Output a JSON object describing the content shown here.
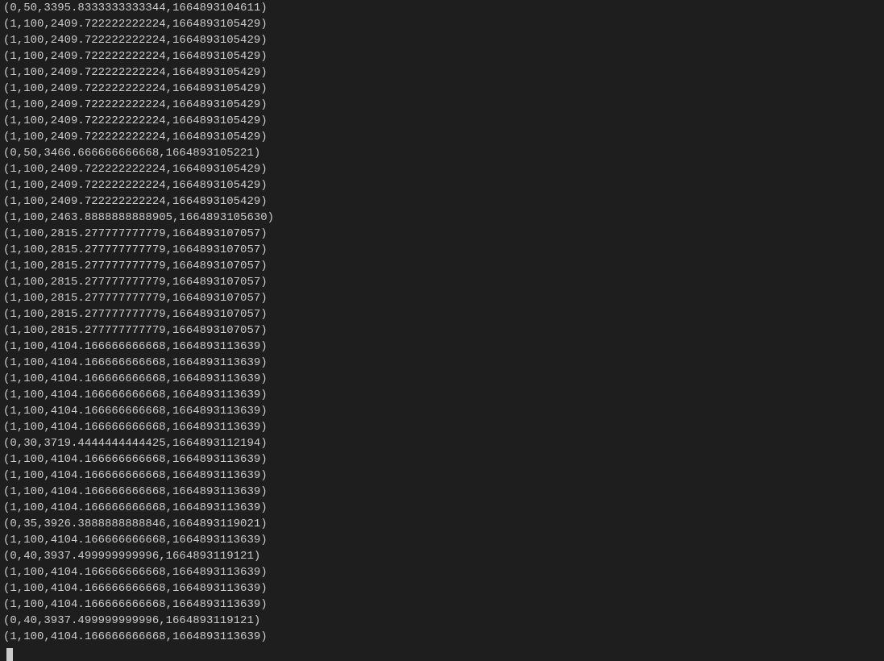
{
  "lines": [
    "(0,50,3395.8333333333344,1664893104611)",
    "(1,100,2409.722222222224,1664893105429)",
    "(1,100,2409.722222222224,1664893105429)",
    "(1,100,2409.722222222224,1664893105429)",
    "(1,100,2409.722222222224,1664893105429)",
    "(1,100,2409.722222222224,1664893105429)",
    "(1,100,2409.722222222224,1664893105429)",
    "(1,100,2409.722222222224,1664893105429)",
    "(1,100,2409.722222222224,1664893105429)",
    "(0,50,3466.666666666668,1664893105221)",
    "(1,100,2409.722222222224,1664893105429)",
    "(1,100,2409.722222222224,1664893105429)",
    "(1,100,2409.722222222224,1664893105429)",
    "(1,100,2463.8888888888905,1664893105630)",
    "(1,100,2815.277777777779,1664893107057)",
    "(1,100,2815.277777777779,1664893107057)",
    "(1,100,2815.277777777779,1664893107057)",
    "(1,100,2815.277777777779,1664893107057)",
    "(1,100,2815.277777777779,1664893107057)",
    "(1,100,2815.277777777779,1664893107057)",
    "(1,100,2815.277777777779,1664893107057)",
    "(1,100,4104.166666666668,1664893113639)",
    "(1,100,4104.166666666668,1664893113639)",
    "(1,100,4104.166666666668,1664893113639)",
    "(1,100,4104.166666666668,1664893113639)",
    "(1,100,4104.166666666668,1664893113639)",
    "(1,100,4104.166666666668,1664893113639)",
    "(0,30,3719.4444444444425,1664893112194)",
    "(1,100,4104.166666666668,1664893113639)",
    "(1,100,4104.166666666668,1664893113639)",
    "(1,100,4104.166666666668,1664893113639)",
    "(1,100,4104.166666666668,1664893113639)",
    "(0,35,3926.3888888888846,1664893119021)",
    "(1,100,4104.166666666668,1664893113639)",
    "(0,40,3937.499999999996,1664893119121)",
    "(1,100,4104.166666666668,1664893113639)",
    "(1,100,4104.166666666668,1664893113639)",
    "(1,100,4104.166666666668,1664893113639)",
    "(0,40,3937.499999999996,1664893119121)",
    "(1,100,4104.166666666668,1664893113639)"
  ]
}
